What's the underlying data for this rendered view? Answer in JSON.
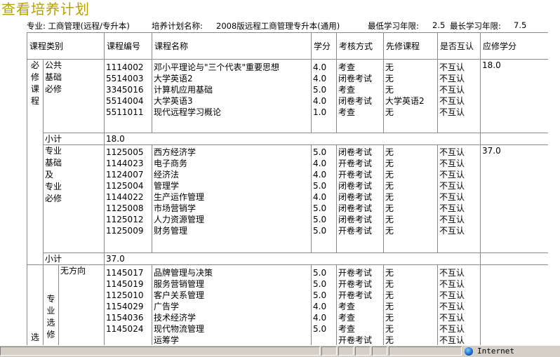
{
  "page": {
    "title": "查看培养计划"
  },
  "info": {
    "major": "专业:  工商管理(远程/专升本)",
    "plan_label": "培养计划名称:",
    "plan_name": "2008版远程工商管理专升本(通用)",
    "min_years_label": "最低学习年限:",
    "min_years": "2.5",
    "max_years_label": "最长学习年限:",
    "max_years": "7.5"
  },
  "table": {
    "headers": [
      "课程类别",
      "课程编号",
      "课程名称",
      "学分",
      "考核方式",
      "先修课程",
      "是否互认",
      "应修学分"
    ],
    "required_label": "必修课程",
    "elective_label": "选修",
    "subtotal_label": "小计",
    "public": {
      "label": "公共\n基础\n必修",
      "codes": [
        "1114002",
        "5514003",
        "3345016",
        "5514004",
        "5511011"
      ],
      "names": [
        "邓小平理论与\"三个代表\"重要思想",
        "大学英语2",
        "计算机应用基础",
        "大学英语3",
        "现代远程学习概论"
      ],
      "credits": [
        "4.0",
        "4.0",
        "5.0",
        "4.0",
        "1.0"
      ],
      "exams": [
        "考查",
        "闭卷考试",
        "考查",
        "闭卷考试",
        "考查"
      ],
      "prereqs": [
        "无",
        "无",
        "无",
        "大学英语2",
        "无"
      ],
      "mutual": [
        "不互认",
        "不互认",
        "不互认",
        "不互认",
        "不互认"
      ],
      "required_credits": "18.0",
      "subtotal": "18.0"
    },
    "major_req": {
      "label": "专业\n基础\n及\n专业\n必修",
      "codes": [
        "1125005",
        "1144023",
        "1124007",
        "1125004",
        "1144022",
        "1125008",
        "1125012",
        "1125009"
      ],
      "names": [
        "西方经济学",
        "电子商务",
        "经济法",
        "管理学",
        "生产运作管理",
        "市场营销学",
        "人力资源管理",
        "财务管理"
      ],
      "credits": [
        "5.0",
        "4.0",
        "4.0",
        "5.0",
        "4.0",
        "5.0",
        "5.0",
        "5.0"
      ],
      "exams": [
        "闭卷考试",
        "开卷考试",
        "开卷考试",
        "闭卷考试",
        "闭卷考试",
        "闭卷考试",
        "闭卷考试",
        "开卷考试"
      ],
      "prereqs": [
        "无",
        "无",
        "无",
        "无",
        "无",
        "无",
        "无",
        "无"
      ],
      "mutual": [
        "不互认",
        "不互认",
        "不互认",
        "不互认",
        "不互认",
        "不互认",
        "不互认",
        "不互认"
      ],
      "required_credits": "37.0",
      "subtotal": "37.0"
    },
    "major_elective": {
      "label": "专\n业\n选\n修",
      "direction": "无方向",
      "codes": [
        "1145017",
        "1145019",
        "1125010",
        "1154029",
        "1154036",
        "1145024",
        ""
      ],
      "names": [
        "品牌管理与决策",
        "服务营销管理",
        "客户关系管理",
        "广告学",
        "技术经济学",
        "现代物流管理",
        "运筹学"
      ],
      "credits": [
        "5.0",
        "5.0",
        "5.0",
        "4.0",
        "4.0",
        "5.0",
        ""
      ],
      "exams": [
        "开卷考试",
        "开卷考试",
        "开卷考试",
        "考查",
        "考查",
        "考查",
        "开卷考试"
      ],
      "prereqs": [
        "无",
        "无",
        "无",
        "无",
        "无",
        "无",
        "无"
      ],
      "mutual": [
        "不互认",
        "不互认",
        "不互认",
        "不互认",
        "不互认",
        "不互认",
        "不互认"
      ]
    }
  },
  "statusbar": {
    "zone": "Internet"
  }
}
